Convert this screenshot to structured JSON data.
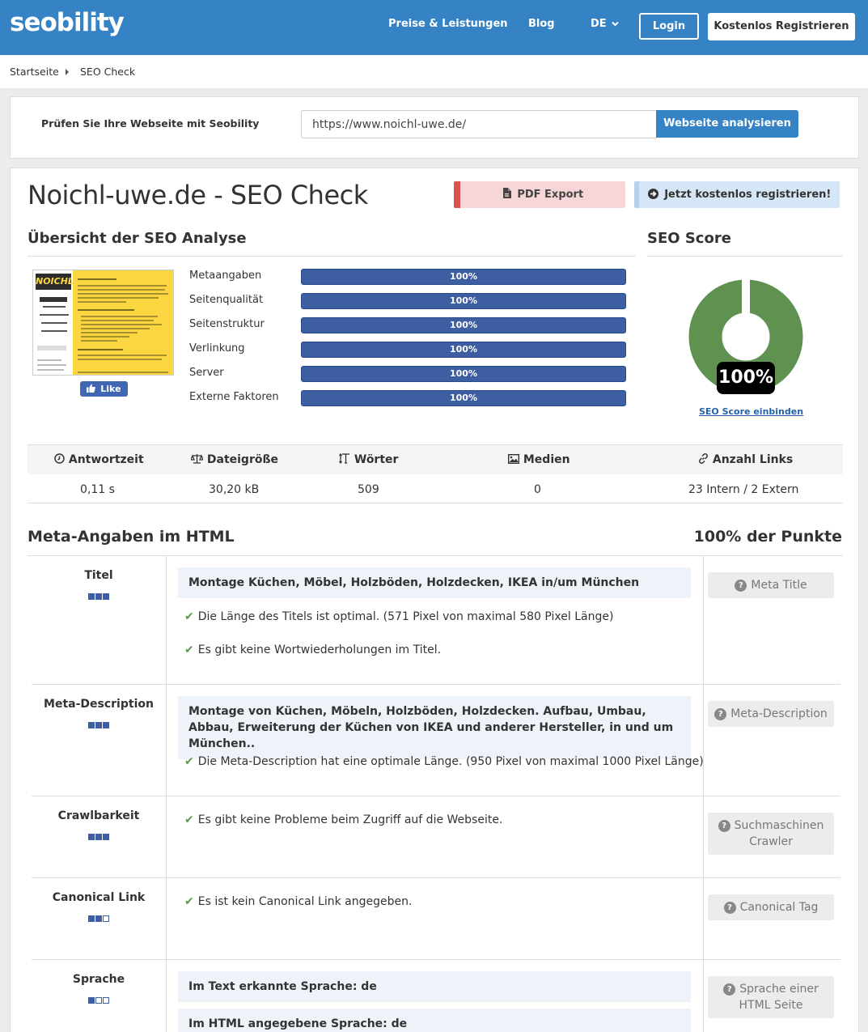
{
  "header": {
    "logo": "seobility",
    "nav": [
      "Preise & Leistungen",
      "Blog",
      "DE"
    ],
    "login": "Login",
    "register": "Kostenlos Registrieren"
  },
  "breadcrumb": [
    "Startseite",
    "SEO Check"
  ],
  "check": {
    "label": "Prüfen Sie Ihre Webseite mit Seobility",
    "url": "https://www.noichl-uwe.de/",
    "button": "Webseite analysieren"
  },
  "main": {
    "title": "Noichl-uwe.de - SEO Check",
    "pdf": "PDF Export",
    "free": "Jetzt kostenlos registrieren!",
    "overview_title": "Übersicht der SEO Analyse",
    "score_title": "SEO Score",
    "like": "Like",
    "thumb_logo": "NOICHL",
    "scores": [
      {
        "label": "Metaangaben",
        "value": "100%",
        "pct": 100
      },
      {
        "label": "Seitenqualität",
        "value": "100%",
        "pct": 100
      },
      {
        "label": "Seitenstruktur",
        "value": "100%",
        "pct": 100
      },
      {
        "label": "Verlinkung",
        "value": "100%",
        "pct": 100
      },
      {
        "label": "Server",
        "value": "100%",
        "pct": 100
      },
      {
        "label": "Externe Faktoren",
        "value": "100%",
        "pct": 100
      }
    ],
    "seo_score": "100%",
    "seo_score_value": 100,
    "embed": "SEO Score einbinden"
  },
  "stats": {
    "headers": [
      "Antwortzeit",
      "Dateigröße",
      "Wörter",
      "Medien",
      "Anzahl Links"
    ],
    "values": [
      "0,11 s",
      "30,20 kB",
      "509",
      "0",
      "23 Intern / 2 Extern"
    ]
  },
  "meta": {
    "title": "Meta-Angaben im HTML",
    "points": "100% der Punkte",
    "rows": [
      {
        "label": "Titel",
        "box": "Montage Küchen, Möbel, Holzböden, Holzdecken, IKEA in/um München",
        "check1": "Die Länge des Titels ist optimal. (571 Pixel von maximal 580 Pixel Länge)",
        "check2": "Es gibt keine Wortwiederholungen im Titel.",
        "help": "Meta Title"
      },
      {
        "label": "Meta-Description",
        "box": "Montage von Küchen, Möbeln, Holzböden, Holzdecken. Aufbau, Umbau, Abbau, Erweiterung der Küchen von IKEA und anderer Hersteller, in und um München..",
        "check1": "Die Meta-Description hat eine optimale Länge. (950 Pixel von maximal 1000 Pixel Länge)",
        "help": "Meta-Description"
      },
      {
        "label": "Crawlbarkeit",
        "check1": "Es gibt keine Probleme beim Zugriff auf die Webseite.",
        "help": "Suchmaschinen Crawler"
      },
      {
        "label": "Canonical Link",
        "check1": "Es ist kein Canonical Link angegeben.",
        "help": "Canonical Tag"
      },
      {
        "label": "Sprache",
        "box": "Im Text erkannte Sprache: de",
        "box2": "Im HTML angegebene Sprache: de",
        "help": "Sprache einer HTML Seite"
      }
    ]
  }
}
